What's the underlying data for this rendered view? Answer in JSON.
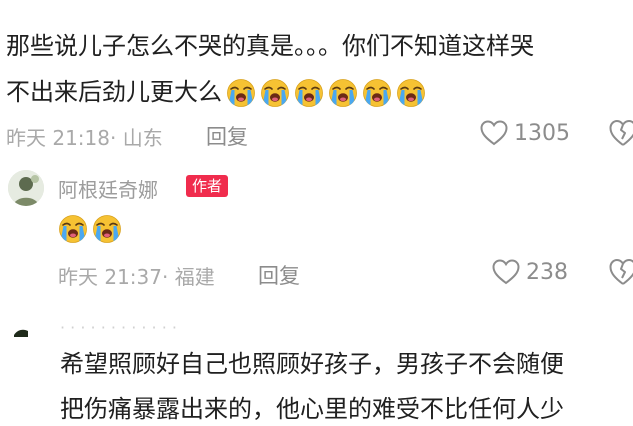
{
  "comment1": {
    "text_line1": "那些说儿子怎么不哭的真是。。。你们不知道这样哭",
    "text_line2": "不出来后劲儿更大么",
    "emoji_name": "loudly-crying-face",
    "emoji_count": 6,
    "time": "昨天 21:18",
    "location": "· 山东",
    "reply_label": "回复",
    "likes": "1305"
  },
  "comment2": {
    "username": "阿根廷奇娜",
    "badge": "作者",
    "emoji_name": "loudly-crying-face",
    "emoji_count": 2,
    "time": "昨天 21:37",
    "location": "· 福建",
    "reply_label": "回复",
    "likes": "238"
  },
  "comment3": {
    "text_line1": "希望照顾好自己也照顾好孩子，男孩子不会随便",
    "text_line2": "把伤痛暴露出来的，他心里的难受不比任何人少"
  },
  "icons": {
    "like": "heart-outline-icon",
    "dislike": "broken-heart-outline-icon",
    "avatar": "avatar-image"
  },
  "colors": {
    "badge": "#f02c4d",
    "meta_text": "#a9a9a9",
    "body_text": "#202020"
  }
}
